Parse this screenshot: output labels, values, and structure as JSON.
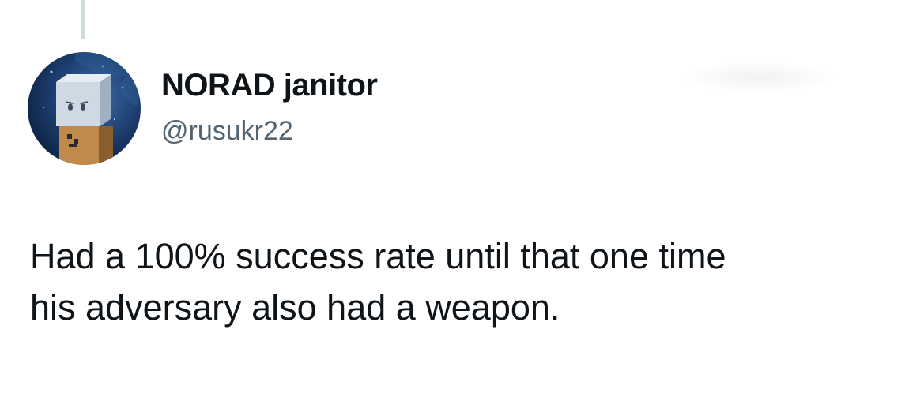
{
  "author": {
    "display_name": "NORAD janitor",
    "handle": "@rusukr22",
    "avatar_icon": "pixel-robot-avatar-icon"
  },
  "tweet": {
    "lines": [
      "Had a 100% success rate until that one time",
      "his adversary also had a weapon."
    ]
  },
  "colors": {
    "text_primary": "#0f1419",
    "text_secondary": "#536471",
    "thread_line": "#cfd9de"
  }
}
